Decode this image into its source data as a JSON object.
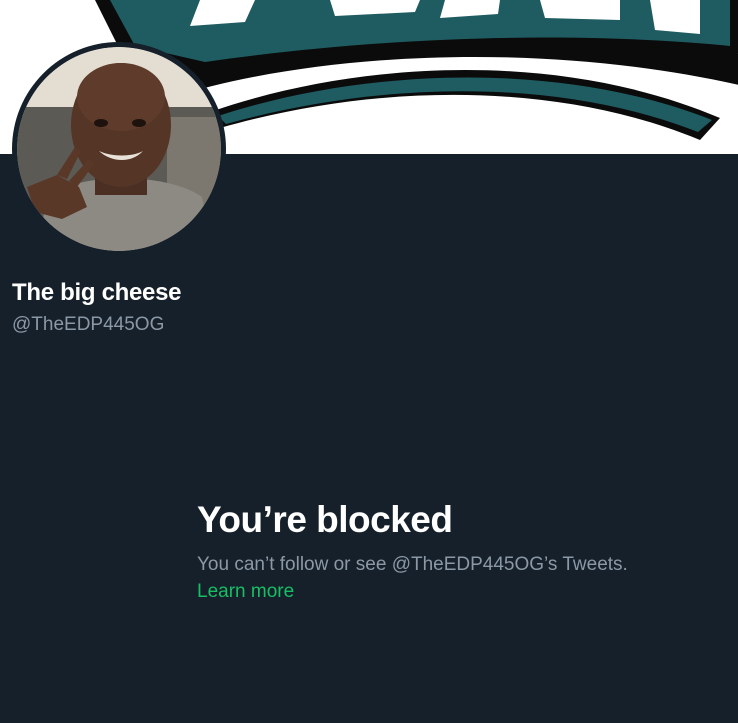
{
  "profile": {
    "display_name": "The big cheese",
    "handle": "@TheEDP445OG"
  },
  "blocked": {
    "title": "You’re blocked",
    "description": "You can’t follow or see @TheEDP445OG’s Tweets.",
    "learn_more": "Learn more"
  },
  "colors": {
    "background": "#15202b",
    "secondary_text": "#8b98a5",
    "link": "#17bf63",
    "banner_teal": "#1f5c61"
  }
}
